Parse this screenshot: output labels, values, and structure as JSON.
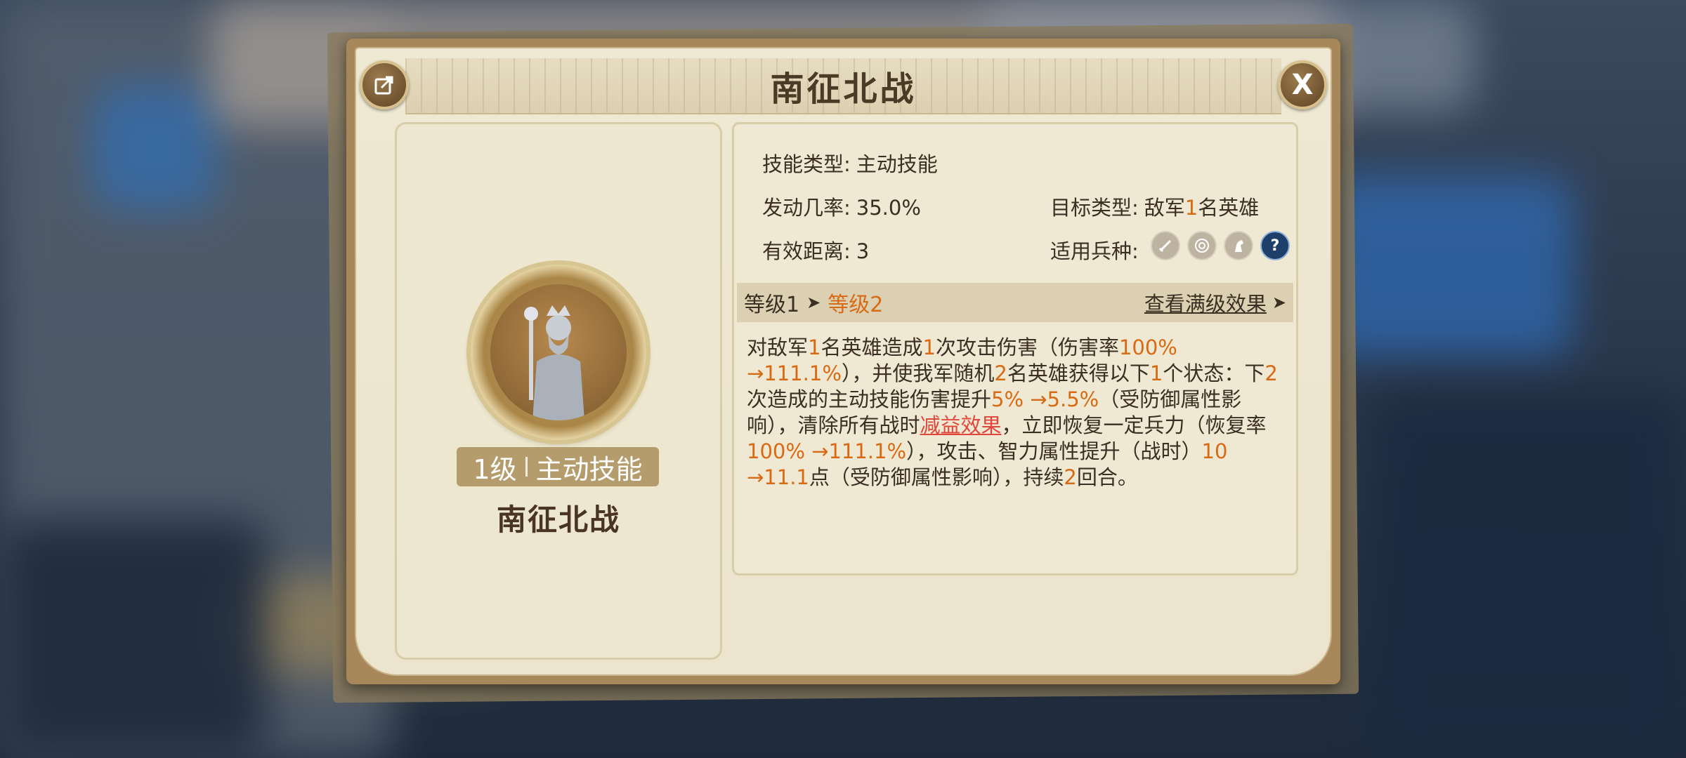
{
  "dialog": {
    "title": "南征北战",
    "close_label": "X"
  },
  "skill_card": {
    "level_label": "1级",
    "type_label": "主动技能",
    "name": "南征北战"
  },
  "info": {
    "skill_type_label": "技能类型:",
    "skill_type_value": "主动技能",
    "trigger_rate_label": "发动几率:",
    "trigger_rate_value": "35.0%",
    "target_label": "目标类型:",
    "target_prefix": "敌军",
    "target_count": "1",
    "target_suffix": "名英雄",
    "range_label": "有效距离:",
    "range_value": "3",
    "troop_label": "适用兵种:",
    "troop_icons": [
      "infantry-icon",
      "archer-icon",
      "cavalry-icon",
      "unknown-icon"
    ]
  },
  "levels": {
    "current": "等级1",
    "next": "等级2",
    "view_full": "查看满级效果"
  },
  "description": {
    "p1": "对敌军",
    "n1": "1",
    "p2": "名英雄造成",
    "n2": "1",
    "p3": "次攻击伤害（伤害率",
    "n3": "100%",
    "n4": "→111.1%",
    "p4": "），并使我军随机",
    "n5": "2",
    "p5": "名英雄获得以下",
    "n6": "1",
    "p6": "个状态：下",
    "n7": "2",
    "p7": "次造成的主动技能伤害提升",
    "n8": "5%",
    "n9": "→5.5%",
    "p8": "（受防御属性影响），清除所有战时",
    "link": "减益效果",
    "p9": "，立即恢复一定兵力（恢复率",
    "n10": "100%",
    "n11": "→111.1%",
    "p10": "），攻击、智力属性提升（战时）",
    "n12": "10",
    "n13": "→11.1",
    "p11": "点（受防御属性影响），持续",
    "n14": "2",
    "p12": "回合。"
  }
}
